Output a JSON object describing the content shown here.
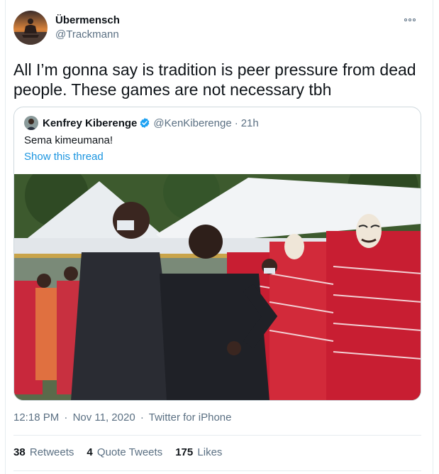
{
  "tweet": {
    "display_name": "Übermensch",
    "handle": "@Trackmann",
    "text": "All I’m gonna say is tradition is peer pressure from dead people. These games are not necessary tbh",
    "time": "12:18 PM",
    "date": "Nov 11, 2020",
    "separator": "·",
    "source": "Twitter for iPhone",
    "more_icon": "ellipsis-icon"
  },
  "quoted": {
    "display_name": "Kenfrey Kiberenge",
    "verified_icon": "verified-badge-icon",
    "handle": "@KenKiberenge",
    "separator": "·",
    "time": "21h",
    "text": "Sema kimeumana!",
    "show_thread": "Show this thread"
  },
  "stats": {
    "retweets_count": "38",
    "retweets_label": "Retweets",
    "quotes_count": "4",
    "quotes_label": "Quote Tweets",
    "likes_count": "175",
    "likes_label": "Likes"
  },
  "colors": {
    "link": "#1b95e0",
    "secondary_text": "#5b7083",
    "border": "#cfd9de",
    "verified": "#1da1f2",
    "shuka_red": "#c81e32"
  }
}
